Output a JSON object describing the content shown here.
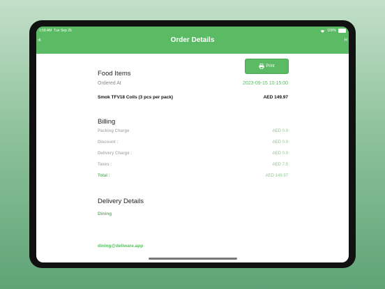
{
  "status": {
    "time": "1:58 AM",
    "date": "Tue Sep 26",
    "battery": "100%"
  },
  "nav": {
    "back": "‹k",
    "title": "Order Details",
    "right": "H"
  },
  "print_button": {
    "label": "Print"
  },
  "food": {
    "title": "Food Items",
    "ordered_at_label": "Ordered At",
    "ordered_at_value": "2023-09-15 10:15:00",
    "item_name": "Smok TFV18 Coils (3 pcs per pack)",
    "item_price": "AED 149.97"
  },
  "billing": {
    "title": "Billing",
    "rows": [
      {
        "label": "Packing Charge",
        "value": "AED 0.0"
      },
      {
        "label": "Discount :",
        "value": "AED 0.0"
      },
      {
        "label": "Delivery Charge :",
        "value": "AED 0.0"
      },
      {
        "label": "Taxes :",
        "value": "AED 7.5"
      }
    ],
    "total_label": "Total :",
    "total_value": "AED 149.97"
  },
  "delivery": {
    "title": "Delivery Details",
    "type": "Dining"
  },
  "contact": {
    "email": "dining@deliware.app"
  },
  "colors": {
    "accent": "#5bbb64"
  },
  "icons": [
    "wifi-icon",
    "battery-icon",
    "printer-icon"
  ]
}
